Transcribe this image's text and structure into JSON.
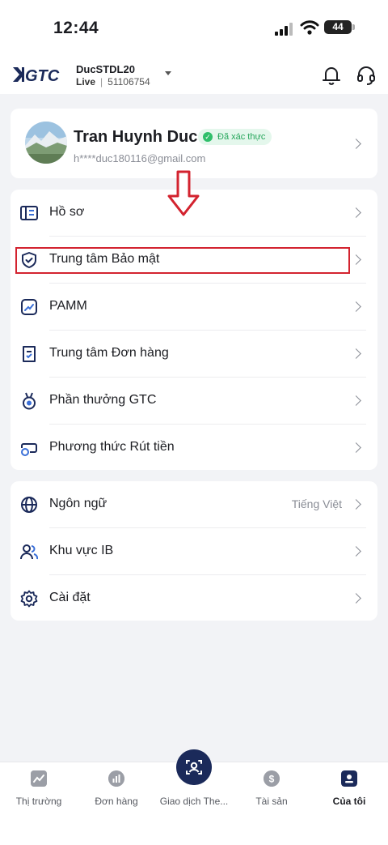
{
  "status_bar": {
    "time": "12:44",
    "battery": "44"
  },
  "header": {
    "logo": "GTC",
    "account_name": "DucSTDL20",
    "account_type": "Live",
    "account_number": "51106754",
    "icons": [
      "bell-icon",
      "headset-icon"
    ]
  },
  "profile": {
    "name": "Tran Huynh Duc",
    "verified_label": "Đã xác thực",
    "email": "h****duc180116@gmail.com"
  },
  "menu_main": [
    {
      "label": "Hồ sơ",
      "icon": "profile-icon"
    },
    {
      "label": "Trung tâm Bảo mật",
      "icon": "shield-icon"
    },
    {
      "label": "PAMM",
      "icon": "trend-icon"
    },
    {
      "label": "Trung tâm Đơn hàng",
      "icon": "order-icon"
    },
    {
      "label": "Phần thưởng GTC",
      "icon": "medal-icon"
    },
    {
      "label": "Phương thức Rút tiền",
      "icon": "withdraw-icon"
    }
  ],
  "menu_settings": [
    {
      "label": "Ngôn ngữ",
      "value": "Tiếng Việt",
      "icon": "globe-icon"
    },
    {
      "label": "Khu vực IB",
      "icon": "users-icon"
    },
    {
      "label": "Cài đặt",
      "icon": "gear-icon"
    }
  ],
  "tabs": [
    {
      "label": "Thị trường",
      "icon": "market-icon"
    },
    {
      "label": "Đơn hàng",
      "icon": "orders-icon"
    },
    {
      "label": "Giao dịch The...",
      "icon": "copy-trade-icon"
    },
    {
      "label": "Tài sản",
      "icon": "assets-icon"
    },
    {
      "label": "Của tôi",
      "icon": "me-icon",
      "active": true
    }
  ],
  "annotation_colors": {
    "highlight": "#d3232f",
    "brand": "#1b2a5a"
  }
}
